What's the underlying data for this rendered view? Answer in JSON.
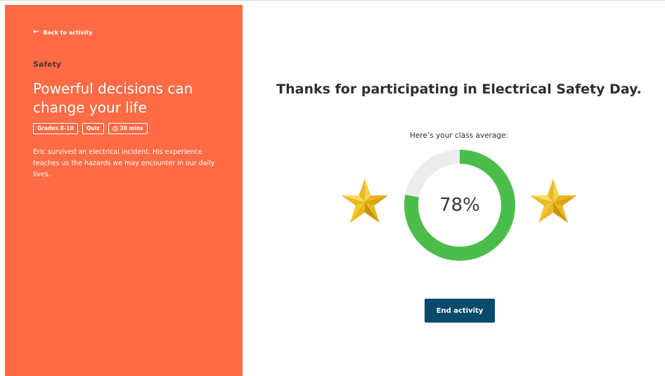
{
  "sidebar": {
    "back_label": "Back to activity",
    "category": "Safety",
    "title": "Powerful decisions can change your life",
    "tags": {
      "grades": "Grades 8–10",
      "type": "Quiz",
      "duration": "30 mins"
    },
    "description": "Eric survived an electrical incident. His experience teaches us the hazards we may encounter in our daily lives.",
    "background_color": "#ff6b45",
    "icons": {
      "back": "arrow-left-icon",
      "duration": "clock-icon"
    }
  },
  "result": {
    "heading": "Thanks for participating in Electrical Safety Day.",
    "subheading": "Here’s your class average:",
    "average_percent": 78,
    "average_label": "78%",
    "ring_color": "#4bbd4b",
    "ring_track_color": "#ececea",
    "star_color": "#e8b820",
    "end_button_label": "End activity",
    "end_button_color": "#0a4a6b"
  }
}
